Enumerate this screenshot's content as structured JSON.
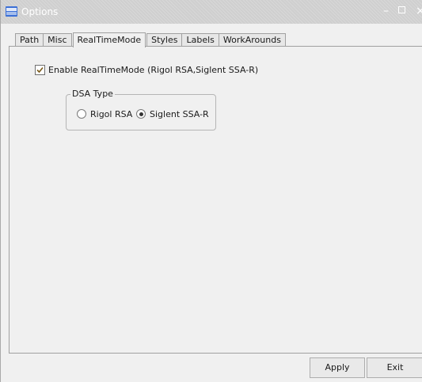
{
  "window": {
    "title": "Options",
    "icon": "app-logo-icon",
    "controls": {
      "minimize": "–",
      "close": "×"
    }
  },
  "tabs": [
    {
      "label": "Path"
    },
    {
      "label": "Misc"
    },
    {
      "label": "RealTimeMode",
      "active": true
    },
    {
      "label": "Styles"
    },
    {
      "label": "Labels"
    },
    {
      "label": "WorkArounds"
    }
  ],
  "realtime": {
    "enable_label": "Enable RealTimeMode (Rigol RSA,Siglent SSA-R)",
    "enable_checked": true,
    "dsa_group_title": "DSA Type",
    "options": [
      {
        "label": "Rigol RSA",
        "checked": false
      },
      {
        "label": "Siglent SSA-R",
        "checked": true
      }
    ]
  },
  "buttons": {
    "apply": "Apply",
    "exit": "Exit"
  }
}
